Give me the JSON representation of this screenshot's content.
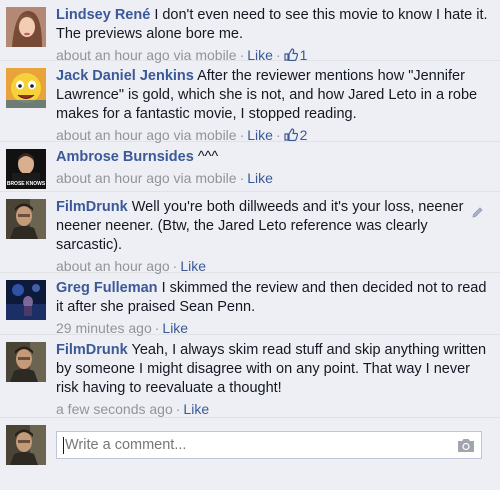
{
  "comments": [
    {
      "author": "Lindsey René",
      "text": "I don't even need to see this movie to know I hate it. The previews alone bore me.",
      "time": "about an hour ago via mobile",
      "like_label": "Like",
      "like_count": "1",
      "avatar": "lindsey-avatar"
    },
    {
      "author": "Jack Daniel Jenkins",
      "text": "After the reviewer mentions how \"Jennifer Lawrence\" is gold, which she is not, and how Jared Leto in a robe makes for a fantastic movie, I stopped reading.",
      "time": "about an hour ago via mobile",
      "like_label": "Like",
      "like_count": "2",
      "avatar": "jack-avatar"
    },
    {
      "author": "Ambrose Burnsides",
      "text": "^^^",
      "time": "about an hour ago via mobile",
      "like_label": "Like",
      "avatar": "ambrose-avatar",
      "avatar_caption": "BROSE KNOWS"
    },
    {
      "author": "FilmDrunk",
      "text": "Well you're both dillweeds and it's your loss, neener neener neener. (Btw, the Jared Leto reference was clearly sarcastic).",
      "time": "about an hour ago",
      "like_label": "Like",
      "avatar": "filmdrunk-avatar",
      "editable": true
    },
    {
      "author": "Greg Fulleman",
      "text": "I skimmed the review and then decided not to read it after she praised Sean Penn.",
      "time": "29 minutes ago",
      "like_label": "Like",
      "avatar": "greg-avatar"
    },
    {
      "author": "FilmDrunk",
      "text": "Yeah, I always skim read stuff and skip anything written by someone I might disagree with on any point. That way I never risk having to reevaluate a thought!",
      "time": "a few seconds ago",
      "like_label": "Like",
      "avatar": "filmdrunk-avatar"
    }
  ],
  "composer": {
    "placeholder": "Write a comment...",
    "avatar": "filmdrunk-avatar",
    "camera_icon": "camera-icon"
  },
  "colors": {
    "link": "#3b5998",
    "meta": "#90949c",
    "background": "#edeff4"
  }
}
